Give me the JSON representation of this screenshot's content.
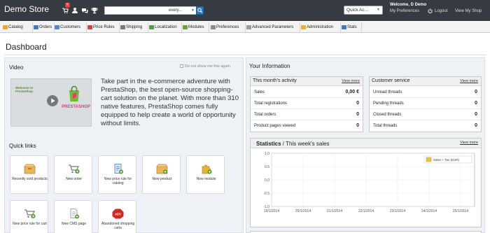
{
  "header": {
    "shop_name": "Demo Store",
    "notification_count": "5",
    "search_placeholder": "",
    "search_type": "every...",
    "quick_access": "Quick Ac...",
    "welcome": "Welcome, D Demo",
    "my_preferences": "My Preferences",
    "logout": "Logout",
    "view_shop": "View My Shop",
    "icons": [
      "cart-icon",
      "customers-icon",
      "messages-icon",
      "trophy-icon",
      "search-icon",
      "power-icon"
    ]
  },
  "menu": {
    "tabs": [
      {
        "label": "Catalog",
        "color": "#e8a73a"
      },
      {
        "label": "Orders",
        "color": "#4a78b5"
      },
      {
        "label": "Customers",
        "color": "#5a87c2"
      },
      {
        "label": "Price Rules",
        "color": "#d2443f"
      },
      {
        "label": "Shipping",
        "color": "#7a7a7a"
      },
      {
        "label": "Localization",
        "color": "#4f9e45"
      },
      {
        "label": "Modules",
        "color": "#6aa33b"
      },
      {
        "label": "Preferences",
        "color": "#8c8c8c"
      },
      {
        "label": "Advanced Parameters",
        "color": "#9a9a9a"
      },
      {
        "label": "Administration",
        "color": "#e3b23a"
      },
      {
        "label": "Stats",
        "color": "#4a78b5"
      }
    ]
  },
  "page": {
    "title": "Dashboard"
  },
  "video": {
    "heading": "Video",
    "dont_show": "Do not show me this again",
    "thumb_title": "Welcome to PrestaShop",
    "thumb_logo": "PRESTASHOP",
    "pitch": "Take part in the e-commerce adventure with PrestaShop, the best open-source shopping-cart solution on the planet. With more than 310 native features, PrestaShop comes fully equipped to help create a world of opportunity without limits."
  },
  "quick_links": {
    "heading": "Quick links",
    "items": [
      {
        "label": "Recently sold products",
        "icon": "box-icon"
      },
      {
        "label": "New order",
        "icon": "new-cart-icon"
      },
      {
        "label": "New price rule for catalog",
        "icon": "price-rule-icon"
      },
      {
        "label": "New product",
        "icon": "new-box-icon"
      },
      {
        "label": "New module",
        "icon": "puzzle-icon"
      },
      {
        "label": "New price rule for cart",
        "icon": "cart-rule-icon"
      },
      {
        "label": "New CMS page",
        "icon": "page-icon"
      },
      {
        "label": "Abandoned shopping carts",
        "icon": "adv-icon"
      }
    ]
  },
  "info": {
    "heading": "Your Information",
    "activity": {
      "title": "This month's activity",
      "more": "View more",
      "rows": [
        {
          "label": "Sales",
          "value": "0,00 €"
        },
        {
          "label": "Total registrations",
          "value": "0"
        },
        {
          "label": "Total orders",
          "value": "0"
        },
        {
          "label": "Product pages viewed",
          "value": "0"
        }
      ]
    },
    "service": {
      "title": "Customer service",
      "more": "View more",
      "rows": [
        {
          "label": "Unread threads",
          "value": "0"
        },
        {
          "label": "Pending threads",
          "value": "0"
        },
        {
          "label": "Closed threads",
          "value": "0"
        },
        {
          "label": "Total threads",
          "value": "0"
        }
      ]
    }
  },
  "statistics": {
    "title_bold": "Statistics",
    "title_rest": " / This week's sales",
    "more": "View more"
  },
  "chart_data": {
    "type": "line",
    "title": "",
    "x": [
      "19/1/2014",
      "20/1/2014",
      "21/1/2014",
      "22/1/2014",
      "23/1/2014",
      "24/1/2014",
      "25/1/2014"
    ],
    "y_ticks": [
      "1.0",
      "0.5",
      "0.0",
      "-0.5",
      "-1.0"
    ],
    "ylim": [
      -1.0,
      1.0
    ],
    "series": [
      {
        "name": "Sales + Tax (EUR)",
        "values": [],
        "color": "#edc240"
      }
    ],
    "legend_position": "top-right",
    "grid": true
  }
}
